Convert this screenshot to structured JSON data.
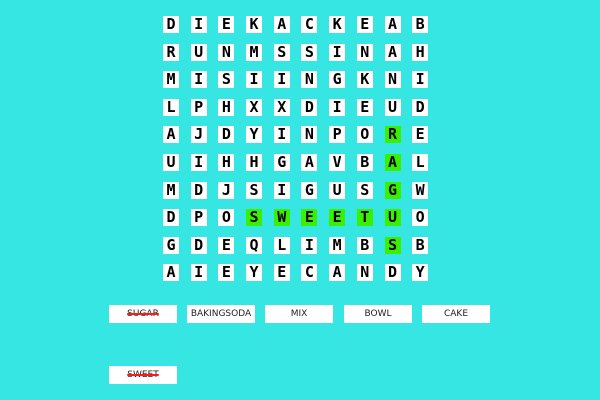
{
  "grid": {
    "rows": [
      [
        "D",
        "I",
        "E",
        "K",
        "A",
        "C",
        "K",
        "E",
        "A",
        "B"
      ],
      [
        "R",
        "U",
        "N",
        "M",
        "S",
        "S",
        "I",
        "N",
        "A",
        "H"
      ],
      [
        "M",
        "I",
        "S",
        "I",
        "I",
        "N",
        "G",
        "K",
        "N",
        "I"
      ],
      [
        "L",
        "P",
        "H",
        "X",
        "X",
        "D",
        "I",
        "E",
        "U",
        "D"
      ],
      [
        "A",
        "J",
        "D",
        "Y",
        "I",
        "N",
        "P",
        "O",
        "R",
        "E"
      ],
      [
        "U",
        "I",
        "H",
        "H",
        "G",
        "A",
        "V",
        "B",
        "A",
        "L"
      ],
      [
        "M",
        "D",
        "J",
        "S",
        "I",
        "G",
        "U",
        "S",
        "G",
        "W"
      ],
      [
        "D",
        "P",
        "O",
        "S",
        "W",
        "E",
        "E",
        "T",
        "U",
        "O"
      ],
      [
        "G",
        "D",
        "E",
        "Q",
        "L",
        "I",
        "M",
        "B",
        "S",
        "B"
      ],
      [
        "A",
        "I",
        "E",
        "Y",
        "E",
        "C",
        "A",
        "N",
        "D",
        "Y"
      ]
    ],
    "found_cells": [
      [
        4,
        8
      ],
      [
        5,
        8
      ],
      [
        6,
        8
      ],
      [
        7,
        8
      ],
      [
        8,
        8
      ],
      [
        7,
        3
      ],
      [
        7,
        4
      ],
      [
        7,
        5
      ],
      [
        7,
        6
      ],
      [
        7,
        7
      ]
    ],
    "highlight_color": "#39f000"
  },
  "words": [
    {
      "label": "SUGAR",
      "found": true
    },
    {
      "label": "BAKINGSODA",
      "found": false
    },
    {
      "label": "MIX",
      "found": false
    },
    {
      "label": "BOWL",
      "found": false
    },
    {
      "label": "CAKE",
      "found": false
    },
    {
      "label": "SWEET",
      "found": true
    }
  ],
  "colors": {
    "background": "#35e6e3",
    "strike": "#ff1a1a"
  }
}
